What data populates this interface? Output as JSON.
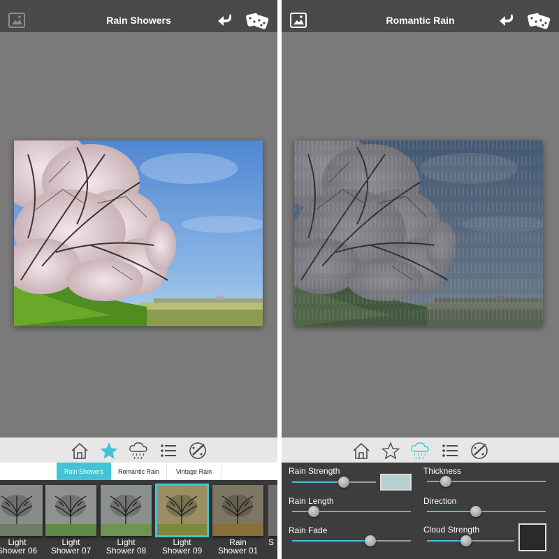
{
  "left": {
    "title": "Rain Showers",
    "icons": {
      "gallery": "gallery-icon",
      "back": "back-arrow-icon",
      "random": "dice-icon"
    },
    "tabbar": [
      {
        "icon": "home-icon",
        "active": false
      },
      {
        "icon": "star-icon",
        "active": true
      },
      {
        "icon": "rain-cloud-icon",
        "active": false
      },
      {
        "icon": "list-icon",
        "active": false
      },
      {
        "icon": "brush-palette-icon",
        "active": false
      }
    ],
    "subtabs": [
      "Rain Showers",
      "Romantic Rain",
      "Vintage Rain"
    ],
    "active_subtab": "Rain Showers",
    "presets": [
      {
        "line1": "Light",
        "line2": "Shower 06",
        "selected": false
      },
      {
        "line1": "Light",
        "line2": "Shower 07",
        "selected": false
      },
      {
        "line1": "Light",
        "line2": "Shower 08",
        "selected": false
      },
      {
        "line1": "Light",
        "line2": "Shower 09",
        "selected": true
      },
      {
        "line1": "Rain",
        "line2": "Shower 01",
        "selected": false
      },
      {
        "line1": "",
        "line2": "S",
        "selected": false
      }
    ]
  },
  "right": {
    "title": "Romantic Rain",
    "icons": {
      "gallery": "gallery-icon",
      "back": "back-arrow-icon",
      "random": "dice-icon"
    },
    "tabbar": [
      {
        "icon": "home-icon",
        "active": false
      },
      {
        "icon": "star-icon",
        "active": false
      },
      {
        "icon": "rain-cloud-icon",
        "active": true
      },
      {
        "icon": "list-icon",
        "active": false
      },
      {
        "icon": "brush-palette-icon",
        "active": false
      }
    ],
    "controls": {
      "rain_strength": {
        "label": "Rain Strength",
        "value": 0.62
      },
      "rain_length": {
        "label": "Rain Length",
        "value": 0.18
      },
      "rain_fade": {
        "label": "Rain Fade",
        "value": 0.66
      },
      "thickness": {
        "label": "Thickness",
        "value": 0.16
      },
      "direction": {
        "label": "Direction",
        "value": 0.41
      },
      "cloud_strength": {
        "label": "Cloud Strength",
        "value": 0.45
      }
    },
    "rain_color": "#b7d1d2",
    "cloud_color": "#2a2a2a"
  },
  "colors": {
    "accent": "#44c3d6",
    "topbar": "#4a4a4a",
    "canvas": "#7a7a7a"
  }
}
